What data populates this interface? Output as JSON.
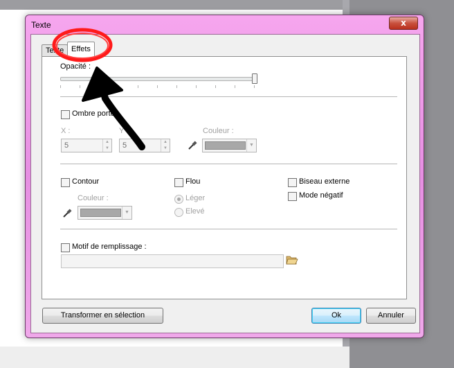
{
  "window": {
    "title": "Texte",
    "close_glyph": "x"
  },
  "tabs": [
    {
      "label": "Texte",
      "active": false
    },
    {
      "label": "Effets",
      "active": true
    }
  ],
  "effects": {
    "opacity": {
      "label": "Opacité :",
      "value_fraction": 1.0
    },
    "shadow": {
      "label": "Ombre portée",
      "checked": false,
      "x_label": "X :",
      "x_value": "5",
      "y_label": "Y :",
      "y_value": "5",
      "color_label": "Couleur :"
    },
    "contour": {
      "label": "Contour",
      "checked": false,
      "color_label": "Couleur :"
    },
    "blur": {
      "label": "Flou",
      "checked": false,
      "options": [
        {
          "label": "Léger",
          "selected": true
        },
        {
          "label": "Elevé",
          "selected": false
        }
      ]
    },
    "bevel": {
      "label": "Biseau externe",
      "checked": false
    },
    "negative": {
      "label": "Mode négatif",
      "checked": false
    },
    "fill_pattern": {
      "label": "Motif de remplissage :",
      "checked": false,
      "value": ""
    }
  },
  "buttons": {
    "transform": "Transformer en sélection",
    "ok": "Ok",
    "cancel": "Annuler"
  },
  "colors": {
    "frame": "#e68fe2",
    "annotation_circle": "#ff1a1a",
    "annotation_arrow": "#000000"
  },
  "icons": {
    "pipette": "pipette-icon",
    "folder": "folder-open-icon"
  }
}
